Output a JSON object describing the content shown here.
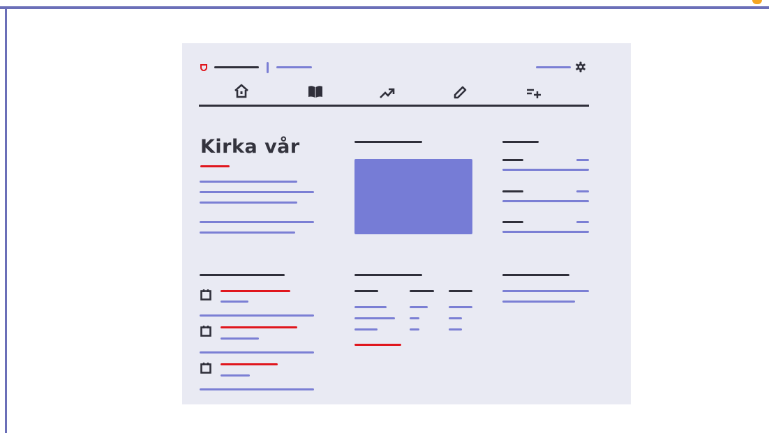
{
  "page": {
    "title": "Kirka vår"
  },
  "colors": {
    "frame": "#6b6fb8",
    "card_background": "#e9eaf3",
    "dark_line": "#2f2f3a",
    "blue_line": "#7b7fd4",
    "accent_red": "#e0161d",
    "image_fill": "#767cd6"
  },
  "header": {
    "logo_icon": "shield-icon",
    "settings_icon": "gear-icon"
  },
  "nav": {
    "items": [
      {
        "icon": "home-icon"
      },
      {
        "icon": "book-icon"
      },
      {
        "icon": "trending-up-icon"
      },
      {
        "icon": "pencil-icon"
      },
      {
        "icon": "playlist-add-icon"
      }
    ]
  },
  "events": {
    "item_icon": "calendar-icon",
    "count": 3
  }
}
